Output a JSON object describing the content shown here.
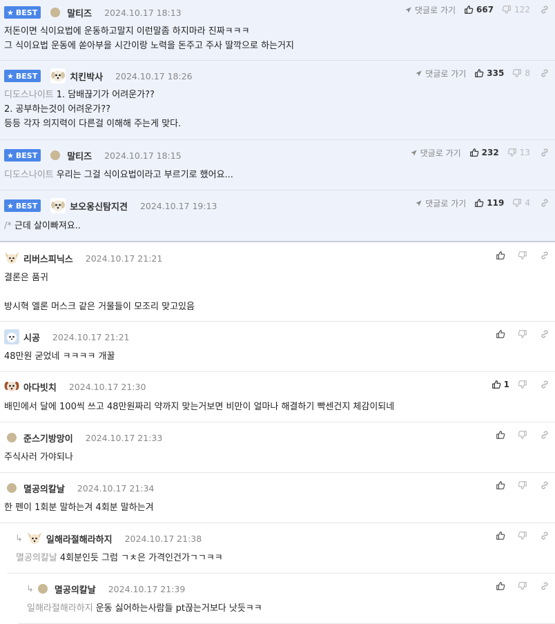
{
  "common": {
    "best_label": "BEST",
    "goto_label": "댓글로 가기"
  },
  "comments": [
    {
      "nick": "말티즈",
      "time": "2024.10.17 18:13",
      "likes": "667",
      "dislikes": "122",
      "lines": [
        "저돈이면 식이요법에 운동하고말지 이런말좀 하지마라 진짜ㅋㅋㅋ",
        "그 식이요법 운동에 쏟아부을 시간이랑 노력을 돈주고 주사 딸깍으로 하는거지"
      ]
    },
    {
      "nick": "치킨박사",
      "time": "2024.10.17 18:26",
      "likes": "335",
      "dislikes": "8",
      "ref": "디도스나이트",
      "lines": [
        "1. 담배끊기가 어려운가??",
        "2. 공부하는것이 어려운가??",
        "등등 각자 의지력이 다른걸 이해해 주는게 맞다."
      ]
    },
    {
      "nick": "말티즈",
      "time": "2024.10.17 18:15",
      "likes": "232",
      "dislikes": "13",
      "ref": "디도스나이트",
      "lines": [
        "우리는 그걸 식이요법이라고 부르기로 했어요..."
      ]
    },
    {
      "nick": "보오옹신탐지견",
      "time": "2024.10.17 19:13",
      "likes": "119",
      "dislikes": "4",
      "ref": "/*",
      "lines": [
        "근데 살이빠져요.."
      ]
    },
    {
      "nick": "리버스피닉스",
      "time": "2024.10.17 21:21",
      "lines": [
        "결론은 품귀",
        "",
        "방시혁 엘론 머스크 같은 거물들이 모조리 맞고있음"
      ]
    },
    {
      "nick": "시공",
      "time": "2024.10.17 21:21",
      "lines": [
        "48만원 굳었네 ㅋㅋㅋㅋ 개꿀"
      ]
    },
    {
      "nick": "아다빗치",
      "time": "2024.10.17 21:30",
      "likes": "1",
      "lines": [
        "배민에서 달에 100씩 쓰고 48만원짜리 약까지 맞는거보면 비만이 얼마나 해결하기 빡센건지 체감이되네"
      ]
    },
    {
      "nick": "준스기방망이",
      "time": "2024.10.17 21:33",
      "lines": [
        "주식사러 가야되나"
      ]
    },
    {
      "nick": "멸공의칼날",
      "time": "2024.10.17 21:34",
      "lines": [
        "한 펜이 1회분 말하는겨 4회분 말하는겨"
      ]
    },
    {
      "nick": "일해라절해라하지",
      "time": "2024.10.17 21:38",
      "ref": "멸공의칼날",
      "lines": [
        "4회분인듯 그럼 ㄱㅊ은 가격인건가ㄱㄱㅋㅋ"
      ]
    },
    {
      "nick": "멸공의칼날",
      "time": "2024.10.17 21:39",
      "ref": "일해라절해라하지",
      "lines": [
        "운동 싫어하는사람들 pt끊는거보다 낫듯ㅋㅋ"
      ]
    }
  ]
}
